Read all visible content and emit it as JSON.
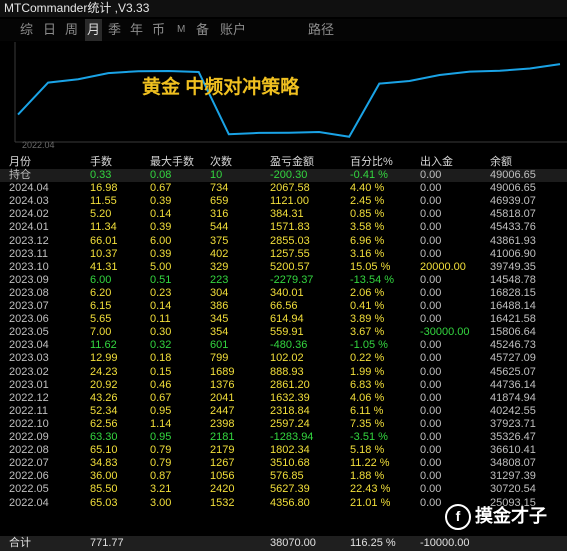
{
  "window": {
    "title": "MTCommander统计 ,V3.33"
  },
  "tabs": [
    {
      "label": "综"
    },
    {
      "label": "日"
    },
    {
      "label": "周"
    },
    {
      "label": "月"
    },
    {
      "label": "季"
    },
    {
      "label": "年"
    },
    {
      "label": "币"
    },
    {
      "label": "M"
    },
    {
      "label": "备"
    },
    {
      "label": "账户"
    },
    {
      "label": "路径"
    }
  ],
  "active_tab": "月",
  "chart": {
    "title": "黄金 中频对冲策略",
    "start_label": "2022.04",
    "line_color": "#1aa3e6",
    "balance_series": [
      25093.15,
      40242.55,
      41874.94,
      44736.14,
      45625.07,
      45727.09,
      45246.73,
      15806.64,
      16421.58,
      16488.14,
      16828.15,
      14548.78,
      39749.35,
      41006.9,
      43861.93,
      45433.76,
      45818.07,
      46939.07,
      49006.65
    ]
  },
  "table": {
    "headers": [
      "月份",
      "手数",
      "最大手数",
      "次数",
      "盈亏金额",
      "百分比%",
      "出入金",
      "余额"
    ],
    "holding": {
      "month": "持仓",
      "lots": "0.33",
      "max_lots": "0.08",
      "count": "10",
      "pnl": "-200.30",
      "pct": "-0.41 %",
      "flow": "0.00",
      "balance": "49006.65",
      "tone": "grn"
    },
    "rows": [
      {
        "month": "2024.04",
        "lots": "16.98",
        "max_lots": "0.67",
        "count": "734",
        "pnl": "2067.58",
        "pct": "4.40 %",
        "flow": "0.00",
        "balance": "49006.65",
        "tone": "yel"
      },
      {
        "month": "2024.03",
        "lots": "11.55",
        "max_lots": "0.39",
        "count": "659",
        "pnl": "1121.00",
        "pct": "2.45 %",
        "flow": "0.00",
        "balance": "46939.07",
        "tone": "yel"
      },
      {
        "month": "2024.02",
        "lots": "5.20",
        "max_lots": "0.14",
        "count": "316",
        "pnl": "384.31",
        "pct": "0.85 %",
        "flow": "0.00",
        "balance": "45818.07",
        "tone": "yel"
      },
      {
        "month": "2024.01",
        "lots": "11.34",
        "max_lots": "0.39",
        "count": "544",
        "pnl": "1571.83",
        "pct": "3.58 %",
        "flow": "0.00",
        "balance": "45433.76",
        "tone": "yel"
      },
      {
        "month": "2023.12",
        "lots": "66.01",
        "max_lots": "6.00",
        "count": "375",
        "pnl": "2855.03",
        "pct": "6.96 %",
        "flow": "0.00",
        "balance": "43861.93",
        "tone": "yel"
      },
      {
        "month": "2023.11",
        "lots": "10.37",
        "max_lots": "0.39",
        "count": "402",
        "pnl": "1257.55",
        "pct": "3.16 %",
        "flow": "0.00",
        "balance": "41006.90",
        "tone": "yel"
      },
      {
        "month": "2023.10",
        "lots": "41.31",
        "max_lots": "5.00",
        "count": "329",
        "pnl": "5200.57",
        "pct": "15.05 %",
        "flow": "20000.00",
        "balance": "39749.35",
        "tone": "yel",
        "flow_tone": "yel"
      },
      {
        "month": "2023.09",
        "lots": "6.00",
        "max_lots": "0.51",
        "count": "223",
        "pnl": "-2279.37",
        "pct": "-13.54 %",
        "flow": "0.00",
        "balance": "14548.78",
        "tone": "grn"
      },
      {
        "month": "2023.08",
        "lots": "6.20",
        "max_lots": "0.23",
        "count": "304",
        "pnl": "340.01",
        "pct": "2.06 %",
        "flow": "0.00",
        "balance": "16828.15",
        "tone": "yel"
      },
      {
        "month": "2023.07",
        "lots": "6.15",
        "max_lots": "0.14",
        "count": "386",
        "pnl": "66.56",
        "pct": "0.41 %",
        "flow": "0.00",
        "balance": "16488.14",
        "tone": "yel"
      },
      {
        "month": "2023.06",
        "lots": "5.65",
        "max_lots": "0.11",
        "count": "345",
        "pnl": "614.94",
        "pct": "3.89 %",
        "flow": "0.00",
        "balance": "16421.58",
        "tone": "yel"
      },
      {
        "month": "2023.05",
        "lots": "7.00",
        "max_lots": "0.30",
        "count": "354",
        "pnl": "559.91",
        "pct": "3.67 %",
        "flow": "-30000.00",
        "balance": "15806.64",
        "tone": "yel",
        "flow_tone": "grn"
      },
      {
        "month": "2023.04",
        "lots": "11.62",
        "max_lots": "0.32",
        "count": "601",
        "pnl": "-480.36",
        "pct": "-1.05 %",
        "flow": "0.00",
        "balance": "45246.73",
        "tone": "grn"
      },
      {
        "month": "2023.03",
        "lots": "12.99",
        "max_lots": "0.18",
        "count": "799",
        "pnl": "102.02",
        "pct": "0.22 %",
        "flow": "0.00",
        "balance": "45727.09",
        "tone": "yel"
      },
      {
        "month": "2023.02",
        "lots": "24.23",
        "max_lots": "0.15",
        "count": "1689",
        "pnl": "888.93",
        "pct": "1.99 %",
        "flow": "0.00",
        "balance": "45625.07",
        "tone": "yel"
      },
      {
        "month": "2023.01",
        "lots": "20.92",
        "max_lots": "0.46",
        "count": "1376",
        "pnl": "2861.20",
        "pct": "6.83 %",
        "flow": "0.00",
        "balance": "44736.14",
        "tone": "yel"
      },
      {
        "month": "2022.12",
        "lots": "43.26",
        "max_lots": "0.67",
        "count": "2041",
        "pnl": "1632.39",
        "pct": "4.06 %",
        "flow": "0.00",
        "balance": "41874.94",
        "tone": "yel"
      },
      {
        "month": "2022.11",
        "lots": "52.34",
        "max_lots": "0.95",
        "count": "2447",
        "pnl": "2318.84",
        "pct": "6.11 %",
        "flow": "0.00",
        "balance": "40242.55",
        "tone": "yel"
      },
      {
        "month": "2022.10",
        "lots": "62.56",
        "max_lots": "1.14",
        "count": "2398",
        "pnl": "2597.24",
        "pct": "7.35 %",
        "flow": "0.00",
        "balance": "37923.71",
        "tone": "yel"
      },
      {
        "month": "2022.09",
        "lots": "63.30",
        "max_lots": "0.95",
        "count": "2181",
        "pnl": "-1283.94",
        "pct": "-3.51 %",
        "flow": "0.00",
        "balance": "35326.47",
        "tone": "grn"
      },
      {
        "month": "2022.08",
        "lots": "65.10",
        "max_lots": "0.79",
        "count": "2179",
        "pnl": "1802.34",
        "pct": "5.18 %",
        "flow": "0.00",
        "balance": "36610.41",
        "tone": "yel"
      },
      {
        "month": "2022.07",
        "lots": "34.83",
        "max_lots": "0.79",
        "count": "1267",
        "pnl": "3510.68",
        "pct": "11.22 %",
        "flow": "0.00",
        "balance": "34808.07",
        "tone": "yel"
      },
      {
        "month": "2022.06",
        "lots": "36.00",
        "max_lots": "0.87",
        "count": "1056",
        "pnl": "576.85",
        "pct": "1.88 %",
        "flow": "0.00",
        "balance": "31297.39",
        "tone": "yel"
      },
      {
        "month": "2022.05",
        "lots": "85.50",
        "max_lots": "3.21",
        "count": "2420",
        "pnl": "5627.39",
        "pct": "22.43 %",
        "flow": "0.00",
        "balance": "30720.54",
        "tone": "yel"
      },
      {
        "month": "2022.04",
        "lots": "65.03",
        "max_lots": "3.00",
        "count": "1532",
        "pnl": "4356.80",
        "pct": "21.01 %",
        "flow": "0.00",
        "balance": "25093.15",
        "tone": "yel"
      }
    ],
    "totals": {
      "month": "合计",
      "lots": "771.77",
      "max_lots": "",
      "count": "",
      "pnl": "38070.00",
      "pct": "116.25 %",
      "flow": "-10000.00",
      "balance": ""
    }
  },
  "watermark": {
    "logo_glyph": "f",
    "text": "摸金才子"
  }
}
